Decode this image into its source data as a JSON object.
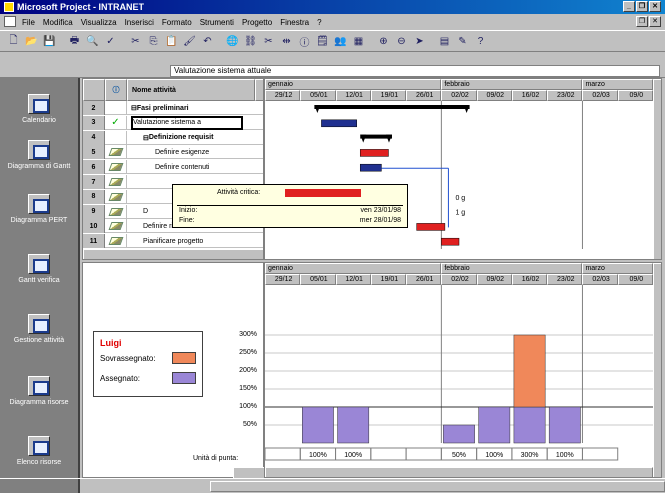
{
  "window": {
    "title": "Microsoft Project - INTRANET"
  },
  "menu": {
    "items": [
      "File",
      "Modifica",
      "Visualizza",
      "Inserisci",
      "Formato",
      "Strumenti",
      "Progetto",
      "Finestra",
      "?"
    ]
  },
  "editbar": {
    "value": "Valutazione sistema attuale"
  },
  "viewbar": {
    "items": [
      "Calendario",
      "Diagramma di Gantt",
      "Diagramma PERT",
      "Gantt verifica",
      "Gestione attività",
      "Diagramma risorse",
      "Elenco risorse"
    ]
  },
  "table": {
    "headers": {
      "name": "Nome attività"
    },
    "rows": [
      {
        "id": "2",
        "name": "Fasi preliminari",
        "level": 0,
        "bold": true,
        "expander": "⊟",
        "indicator": ""
      },
      {
        "id": "3",
        "name": "Valutazione sistema a",
        "level": 1,
        "bold": false,
        "expander": "",
        "indicator": "✓"
      },
      {
        "id": "4",
        "name": "Definizione requisit",
        "level": 1,
        "bold": true,
        "expander": "⊟",
        "indicator": ""
      },
      {
        "id": "5",
        "name": "Definire esigenze",
        "level": 2,
        "bold": false,
        "expander": "",
        "indicator": "pencil"
      },
      {
        "id": "6",
        "name": "Definire contenuti",
        "level": 2,
        "bold": false,
        "expander": "",
        "indicator": "pencil"
      },
      {
        "id": "7",
        "name": "",
        "level": 2,
        "bold": false,
        "expander": "",
        "indicator": "pencil"
      },
      {
        "id": "8",
        "name": "",
        "level": 2,
        "bold": false,
        "expander": "",
        "indicator": "pencil"
      },
      {
        "id": "9",
        "name": "D",
        "level": 1,
        "bold": false,
        "expander": "",
        "indicator": "pencil"
      },
      {
        "id": "10",
        "name": "Definire rischi e strate",
        "level": 1,
        "bold": false,
        "expander": "",
        "indicator": "pencil"
      },
      {
        "id": "11",
        "name": "Pianificare progetto",
        "level": 1,
        "bold": false,
        "expander": "",
        "indicator": "pencil"
      }
    ]
  },
  "timescale": {
    "months": [
      "gennaio",
      "febbraio",
      "marzo"
    ],
    "weeks": [
      "29/12",
      "05/01",
      "12/01",
      "19/01",
      "26/01",
      "02/02",
      "09/02",
      "16/02",
      "23/02",
      "02/03",
      "09/0"
    ]
  },
  "gantt": {
    "bars": [
      {
        "row": 0,
        "start": 1.4,
        "end": 5.8,
        "type": "summary"
      },
      {
        "row": 1,
        "start": 1.6,
        "end": 2.6,
        "type": "normal"
      },
      {
        "row": 2,
        "start": 2.7,
        "end": 3.6,
        "type": "summary"
      },
      {
        "row": 3,
        "start": 2.7,
        "end": 3.5,
        "type": "critical"
      },
      {
        "row": 4,
        "start": 2.7,
        "end": 3.3,
        "type": "normal"
      },
      {
        "row": 8,
        "start": 4.3,
        "end": 5.1,
        "type": "critical"
      },
      {
        "row": 9,
        "start": 5.0,
        "end": 5.5,
        "type": "critical"
      }
    ],
    "labels": [
      {
        "row": 6,
        "text": "0 g"
      },
      {
        "row": 7,
        "text": "1 g"
      }
    ]
  },
  "tooltip": {
    "title": "Attività critica:",
    "start_label": "Inizio:",
    "start_value": "ven 23/01/98",
    "end_label": "Fine:",
    "end_value": "mer 28/01/98"
  },
  "legend": {
    "name": "Luigi",
    "over_label": "Sovrassegnato:",
    "assigned_label": "Assegnato:"
  },
  "histogram": {
    "yticks": [
      "300%",
      "250%",
      "200%",
      "150%",
      "100%",
      "50%"
    ],
    "peak_label": "Unità di punta:",
    "units": [
      "",
      "100%",
      "100%",
      "",
      "",
      "50%",
      "100%",
      "300%",
      "100%",
      ""
    ],
    "assigned": [
      0,
      100,
      100,
      0,
      0,
      50,
      100,
      100,
      100,
      0
    ],
    "over": [
      0,
      0,
      0,
      0,
      0,
      0,
      0,
      200,
      0,
      0
    ],
    "colors": {
      "assigned": "#9a86d6",
      "over": "#f0885a"
    }
  }
}
